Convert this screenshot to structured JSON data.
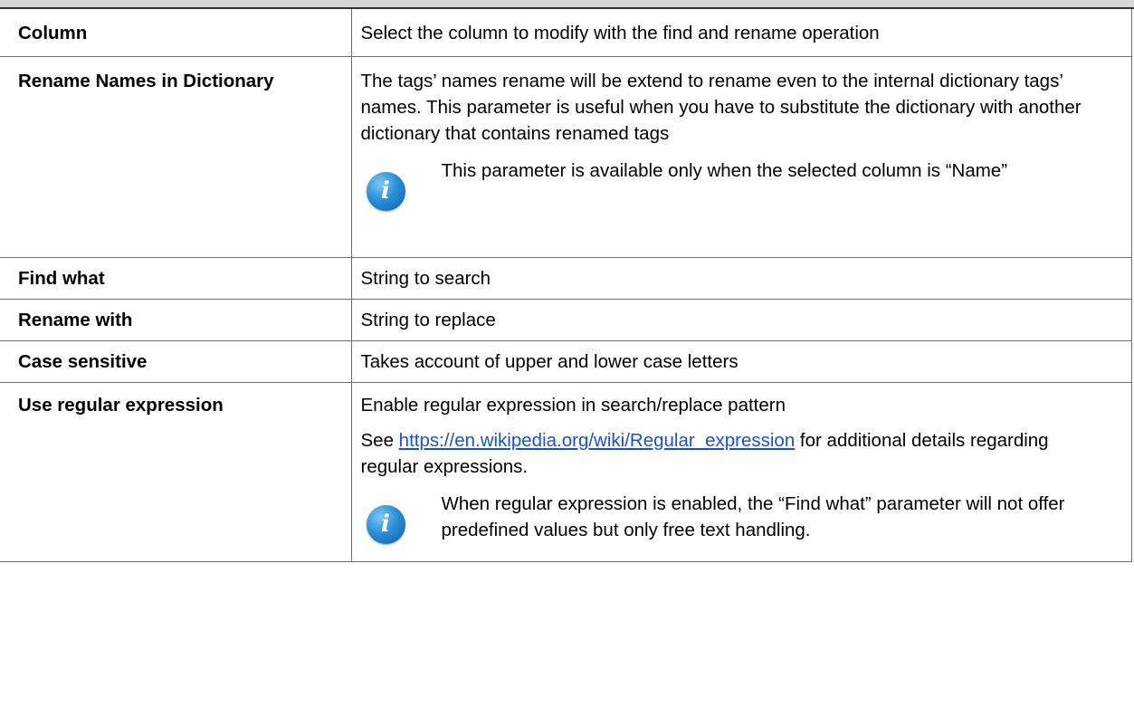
{
  "rows": [
    {
      "name": "Column",
      "desc": "Select the column to modify with the find and rename operation"
    },
    {
      "name": "Rename Names in Dictionary",
      "desc": "The tags’ names rename will be extend to rename even to the internal dictionary tags’ names. This parameter is useful when you have to substitute the dictionary with another dictionary that contains renamed tags",
      "note": "This parameter is available only when the selected column is “Name”",
      "note_icon": "info-icon"
    },
    {
      "name": "Find what",
      "desc": "String to search"
    },
    {
      "name": "Rename with",
      "desc": "String to replace"
    },
    {
      "name": "Case sensitive",
      "desc": "Takes account of upper and lower case letters"
    },
    {
      "name": "Use regular expression",
      "desc": "Enable regular expression in search/replace pattern",
      "see_prefix": "See ",
      "link_text": "https://en.wikipedia.org/wiki/Regular_expression",
      "see_suffix": " for additional details regarding regular expressions.",
      "note": "When regular expression is enabled, the “Find what” parameter will not offer predefined values but only free text handling.",
      "note_icon": "info-icon"
    }
  ],
  "colors": {
    "header_bar": "#d6d6d6",
    "border": "#6e6e6e",
    "link": "#1a53c7",
    "icon": "#2a8fd8"
  }
}
